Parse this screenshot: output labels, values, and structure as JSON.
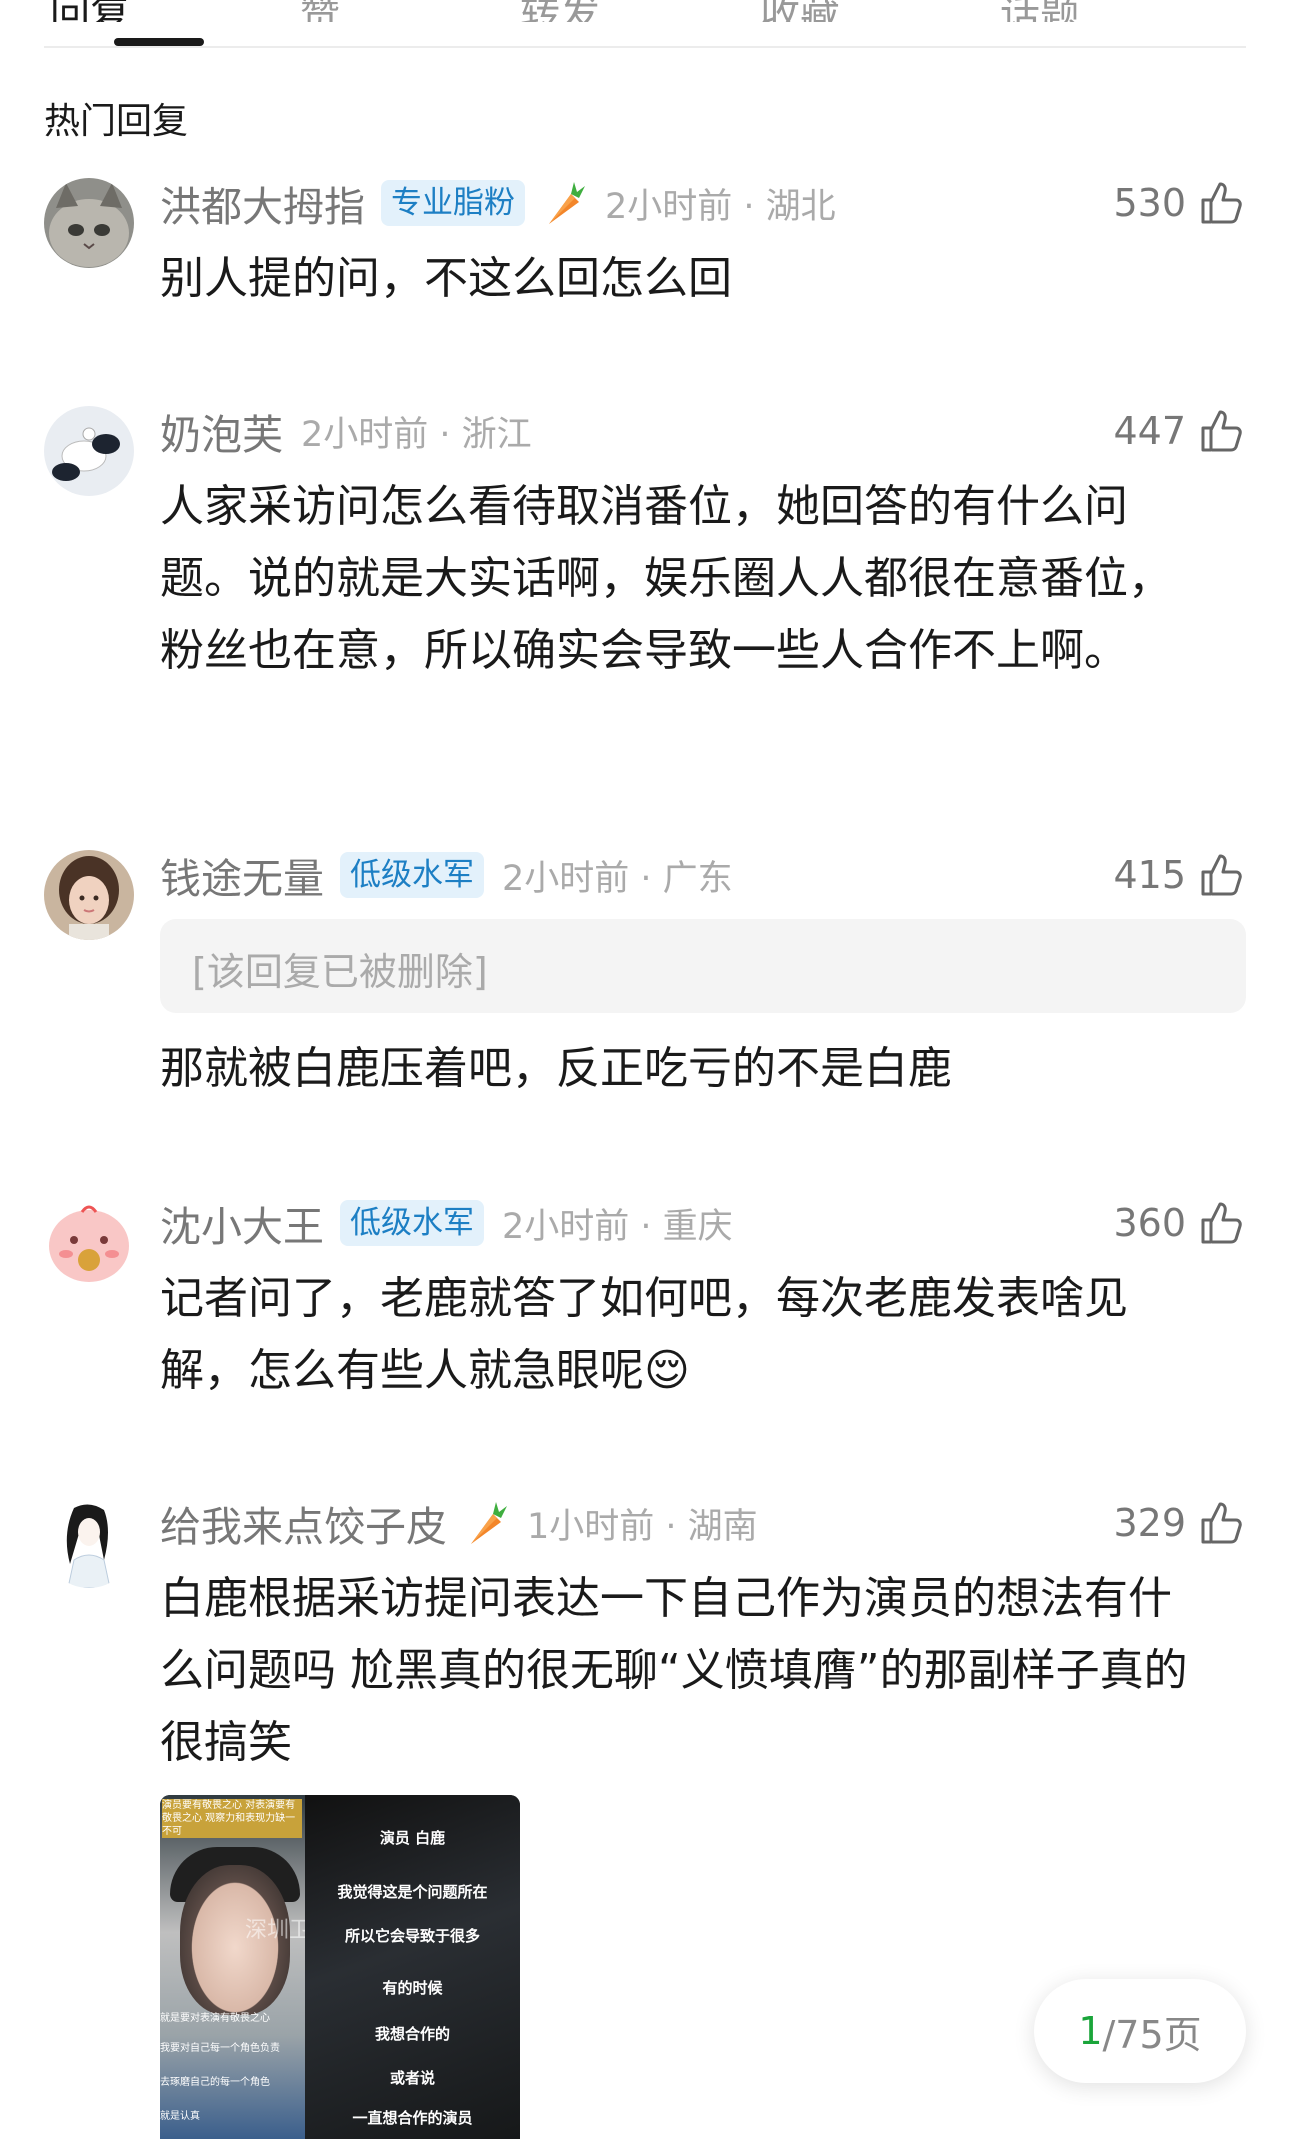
{
  "tabs": [
    "回复",
    "赞",
    "转发",
    "收藏",
    "话题"
  ],
  "section_title": "热门回复",
  "comments": [
    {
      "username": "洪都大拇指",
      "badge": "专业脂粉",
      "has_carrot": true,
      "time_location": "2小时前 · 湖北",
      "likes": "530",
      "text": "别人提的问，不这么回怎么回"
    },
    {
      "username": "奶泡芙",
      "badge": "",
      "has_carrot": false,
      "time_location": "2小时前 · 浙江",
      "likes": "447",
      "text": "人家采访问怎么看待取消番位，她回答的有什么问题。说的就是大实话啊，娱乐圈人人都很在意番位，粉丝也在意，所以确实会导致一些人合作不上啊。"
    },
    {
      "username": "钱途无量",
      "badge": "低级水军",
      "has_carrot": false,
      "time_location": "2小时前 · 广东",
      "likes": "415",
      "quoted": "[该回复已被删除]",
      "text": "那就被白鹿压着吧，反正吃亏的不是白鹿"
    },
    {
      "username": "沈小大王",
      "badge": "低级水军",
      "has_carrot": false,
      "time_location": "2小时前 · 重庆",
      "likes": "360",
      "text": "记者问了，老鹿就答了如何吧，每次老鹿发表啥见解，怎么有些人就急眼呢😌"
    },
    {
      "username": "给我来点饺子皮",
      "badge": "",
      "has_carrot": true,
      "time_location": "1小时前 · 湖南",
      "likes": "329",
      "text": "白鹿根据采访提问表达一下自己作为演员的想法有什么问题吗 尬黑真的很无聊“义愤填膺”的那副样子真的很搞笑"
    }
  ],
  "thumbnail": {
    "top_text": "演员要有敬畏之心 对表演要有敬畏之心 观察力和表现力缺一不可",
    "watermark": "深圳卫视",
    "left_captions": [
      "就是要对表演有敬畏之心",
      "我要对自己每一个角色负责",
      "去琢磨自己的每一个角色",
      "就是认真"
    ],
    "right_lines": [
      "演员 白鹿",
      "我觉得这是个问题所在",
      "所以它会导致于很多",
      "有的时候",
      "我想合作的",
      "或者说",
      "一直想合作的演员"
    ]
  },
  "pager": {
    "current": "1",
    "total": "/75页"
  },
  "colors": {
    "badge_text": "#1d7fc4",
    "badge_bg": "#e3f1fb",
    "pager_current": "#1aa53a"
  }
}
